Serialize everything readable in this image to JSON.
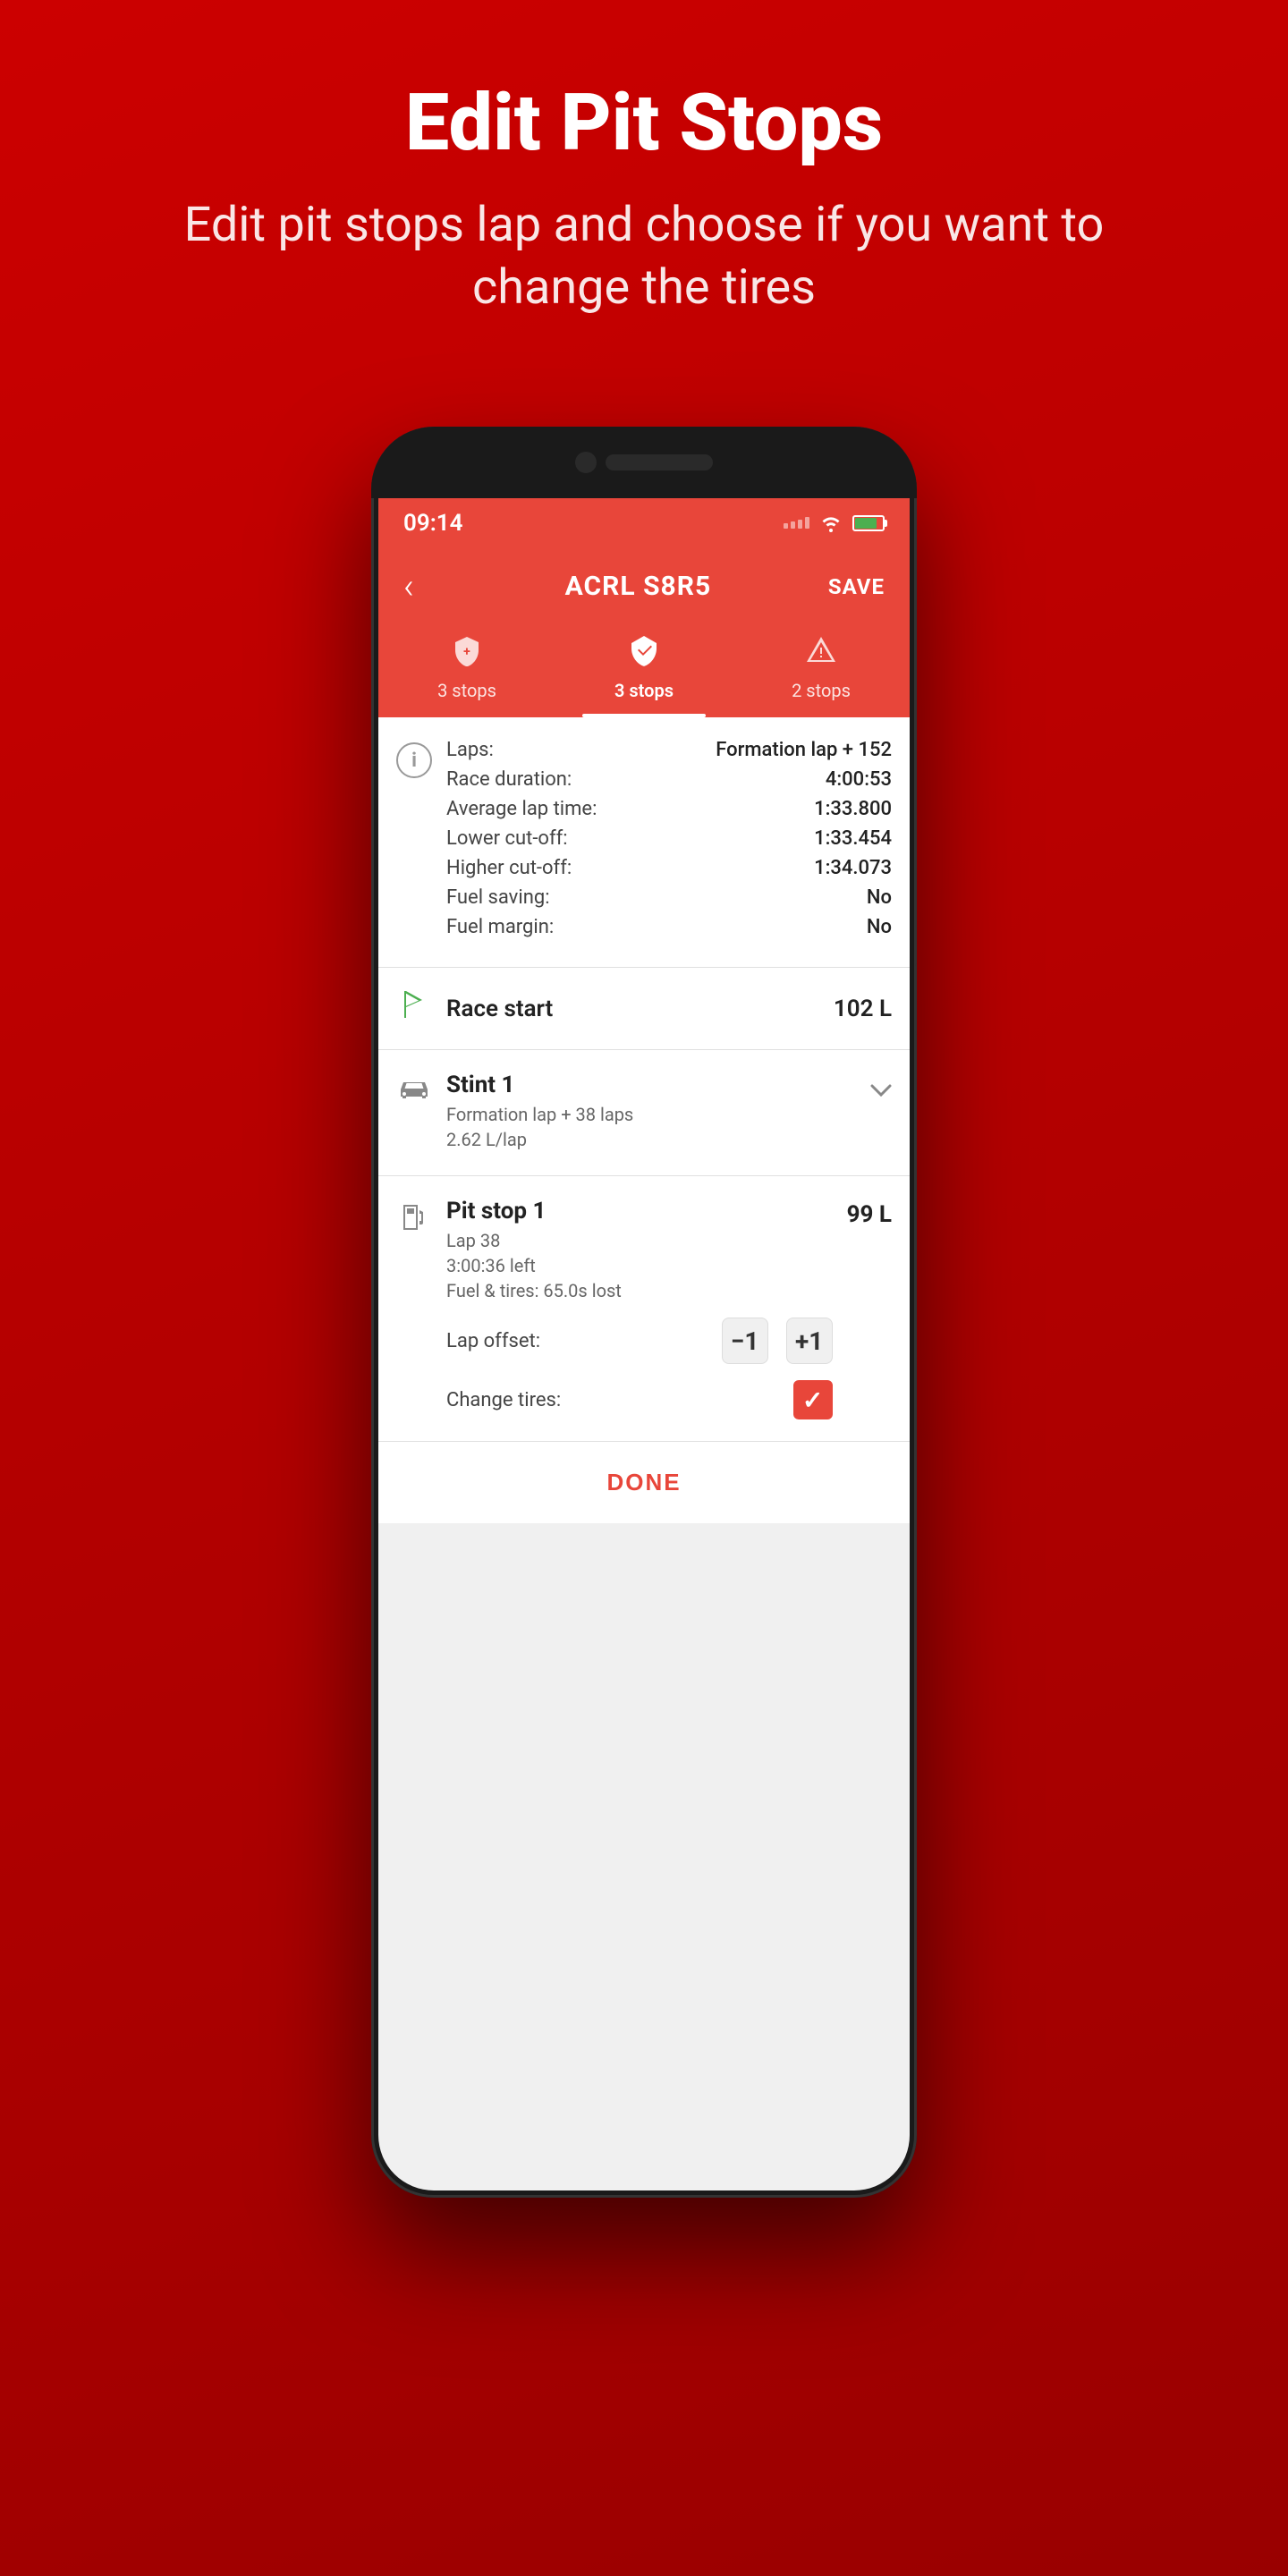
{
  "page": {
    "title": "Edit Pit Stops",
    "subtitle": "Edit pit stops lap and choose if you want to change the tires"
  },
  "status_bar": {
    "time": "09:14"
  },
  "app_header": {
    "title": "ACRL S8R5",
    "save_label": "SAVE",
    "back_label": "‹"
  },
  "tabs": [
    {
      "id": "tab1",
      "label": "3 stops",
      "icon": "🛡",
      "active": false
    },
    {
      "id": "tab2",
      "label": "3 stops",
      "icon": "⚖",
      "active": true
    },
    {
      "id": "tab3",
      "label": "2 stops",
      "icon": "⚠",
      "active": false
    }
  ],
  "race_info": {
    "laps_label": "Laps:",
    "laps_value": "Formation lap + 152",
    "race_duration_label": "Race duration:",
    "race_duration_value": "4:00:53",
    "avg_lap_label": "Average lap time:",
    "avg_lap_value": "1:33.800",
    "lower_cutoff_label": "Lower cut-off:",
    "lower_cutoff_value": "1:33.454",
    "higher_cutoff_label": "Higher cut-off:",
    "higher_cutoff_value": "1:34.073",
    "fuel_saving_label": "Fuel saving:",
    "fuel_saving_value": "No",
    "fuel_margin_label": "Fuel margin:",
    "fuel_margin_value": "No"
  },
  "race_start": {
    "label": "Race start",
    "value": "102 L"
  },
  "stint": {
    "title": "Stint 1",
    "sub1": "Formation lap + 38 laps",
    "sub2": "2.62 L/lap"
  },
  "pit_stop": {
    "title": "Pit stop 1",
    "sub1": "Lap 38",
    "sub2": "3:00:36 left",
    "sub3": "Fuel & tires: 65.0s lost",
    "value": "99 L",
    "lap_offset_label": "Lap offset:",
    "offset_minus": "−1",
    "offset_plus": "+1",
    "change_tires_label": "Change tires:",
    "done_label": "DONE"
  }
}
